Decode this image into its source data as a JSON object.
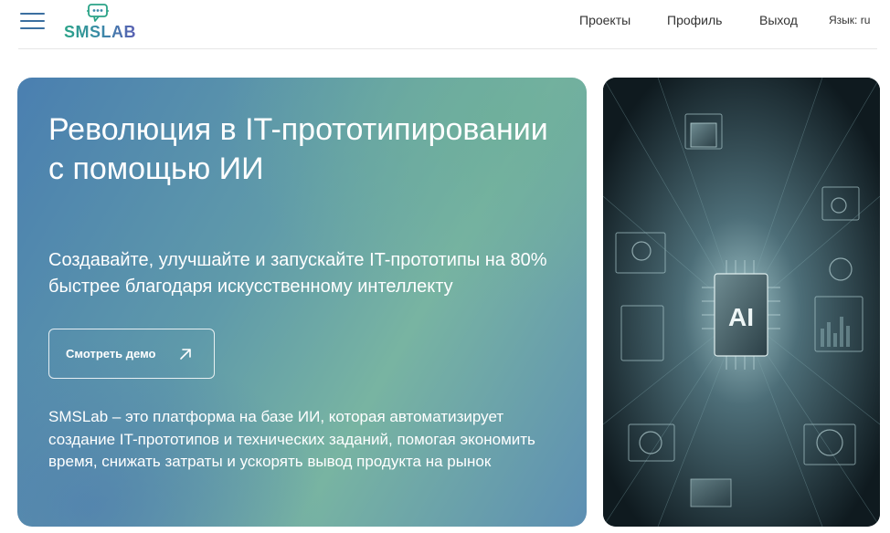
{
  "header": {
    "logo_text": "SMSLAB",
    "nav": {
      "projects": "Проекты",
      "profile": "Профиль",
      "exit": "Выход"
    },
    "language": "Язык: ru"
  },
  "hero": {
    "title": "Революция в IT-прототипировании с помощью ИИ",
    "subtitle": "Создавайте, улучшайте и запускайте IT-прототипы на 80% быстрее благодаря искусственному интеллекту",
    "demo_button": "Смотреть демо",
    "description": "SMSLab – это платформа на базе ИИ, которая автоматизирует создание IT-прототипов и технических заданий, помогая экономить время, снижать затраты и ускорять вывод продукта на рынок"
  },
  "image": {
    "chip_label": "AI"
  },
  "colors": {
    "accent": "#3b6fa0",
    "hero_gradient_start": "#4a7fb0",
    "hero_gradient_mid": "#78b4a2"
  }
}
